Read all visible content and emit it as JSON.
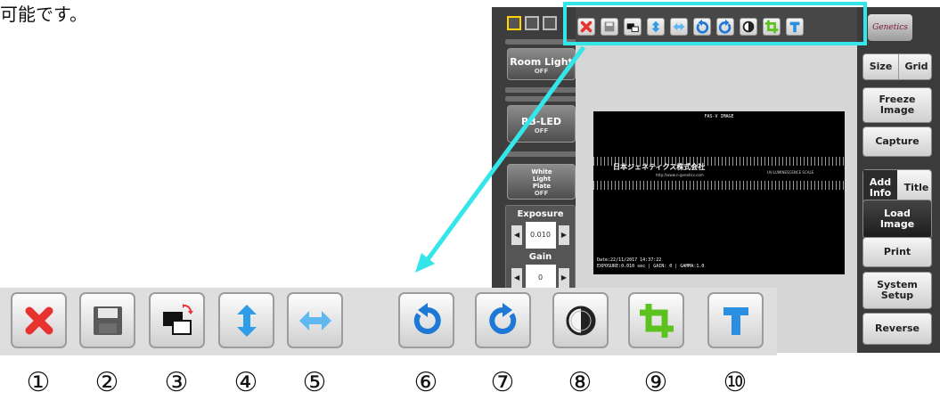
{
  "page": {
    "top_note": "可能です。"
  },
  "software": {
    "left_panel": {
      "room_light": {
        "label": "Room Light",
        "state": "OFF"
      },
      "led": {
        "label": "RB-LED",
        "state": "OFF"
      },
      "white_light": {
        "label": "White Light Plate",
        "state": "OFF"
      },
      "exposure": {
        "label": "Exposure",
        "value": "0.010"
      },
      "gain": {
        "label": "Gain",
        "value": "0"
      }
    },
    "image": {
      "title": "FAS-V IMAGE",
      "logo_text": "日本ジェネティクス株式会社",
      "logo_url": "http://www.n-genetics.com",
      "scale_text": "UV-LUMINESCENCE SCALE",
      "footer_line1": "Date:22/11/2017 14:37:22",
      "footer_line2": "EXPOSURE:0.010 sec | GAIN: 0 | GAMMA:1.0"
    },
    "right_panel": {
      "brand": "Genetics",
      "size": "Size",
      "grid": "Grid",
      "freeze": "Freeze Image",
      "capture": "Capture",
      "add_info": "Add Info",
      "title": "Title",
      "load": "Load Image",
      "print": "Print",
      "system_setup": "System Setup",
      "reverse": "Reverse"
    }
  },
  "toolbar": {
    "buttons": [
      {
        "icon": "close-icon",
        "number": "①",
        "color": "#e8322f"
      },
      {
        "icon": "save-icon",
        "number": "②",
        "color": "#5a5a5a"
      },
      {
        "icon": "invert-swap-icon",
        "number": "③",
        "color": "#111111"
      },
      {
        "icon": "vertical-flip-icon",
        "number": "④",
        "color": "#2e9ce6"
      },
      {
        "icon": "horizontal-flip-icon",
        "number": "⑤",
        "color": "#5fb8f0"
      },
      {
        "icon": "rotate-left-icon",
        "number": "⑥",
        "color": "#1e78d6"
      },
      {
        "icon": "rotate-right-icon",
        "number": "⑦",
        "color": "#1e78d6"
      },
      {
        "icon": "contrast-icon",
        "number": "⑧",
        "color": "#222222"
      },
      {
        "icon": "crop-icon",
        "number": "⑨",
        "color": "#5cc21f"
      },
      {
        "icon": "text-tool-icon",
        "number": "⑩",
        "color": "#2a8fe0"
      }
    ]
  },
  "colors": {
    "callout": "#34e6ea"
  }
}
